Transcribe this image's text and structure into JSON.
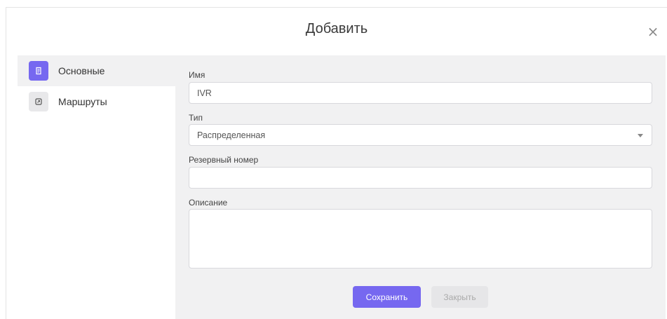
{
  "dialog": {
    "title": "Добавить",
    "close_symbol": "×"
  },
  "sidebar": {
    "items": [
      {
        "label": "Основные",
        "icon": "document-icon",
        "active": true
      },
      {
        "label": "Маршруты",
        "icon": "route-icon",
        "active": false
      }
    ]
  },
  "form": {
    "name": {
      "label": "Имя",
      "value": "IVR"
    },
    "type": {
      "label": "Тип",
      "value": "Распределенная"
    },
    "backup": {
      "label": "Резервный номер",
      "value": ""
    },
    "description": {
      "label": "Описание",
      "value": ""
    }
  },
  "buttons": {
    "save_label": "Сохранить",
    "close_label": "Закрыть"
  },
  "colors": {
    "accent": "#7668f0",
    "panel": "#f1f1f2",
    "disabled": "#e6e6e8"
  }
}
